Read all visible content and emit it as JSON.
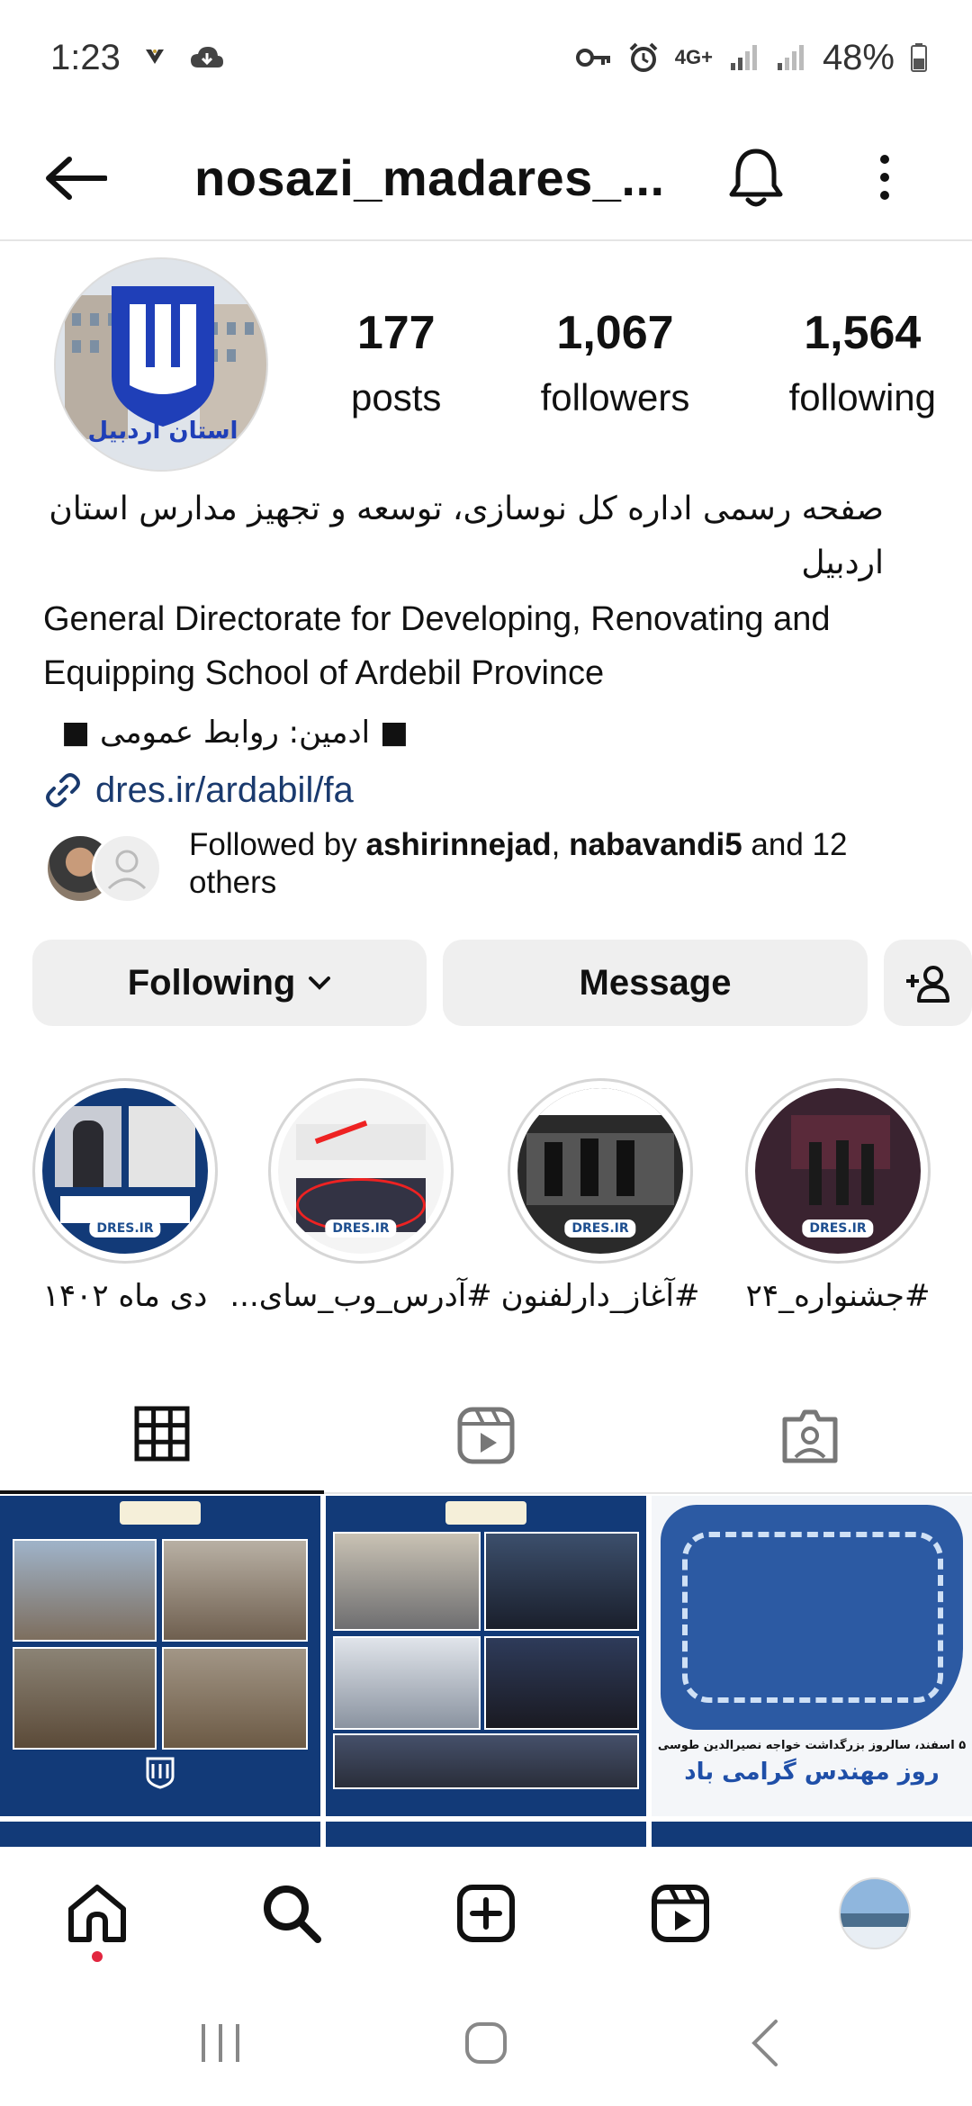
{
  "status_bar": {
    "time": "1:23",
    "network": "4G+",
    "battery": "48%"
  },
  "header": {
    "username": "nosazi_madares_..."
  },
  "profile": {
    "stats": [
      {
        "value": "177",
        "label": "posts"
      },
      {
        "value": "1,067",
        "label": "followers"
      },
      {
        "value": "1,564",
        "label": "following"
      }
    ],
    "bio_fa_line1": "صفحه رسمی اداره کل نوسازی، توسعه و تجهیز مدارس استان",
    "bio_fa_line2": "اردبیل",
    "bio_en_line1": "General Directorate for Developing, Renovating and",
    "bio_en_line2": "Equipping School of Ardebil Province",
    "bio_admin": "■ ادمین: روابط عمومی ■",
    "link": "dres.ir/ardabil/fa",
    "avatar_text": "استان اردبیل"
  },
  "followed_by": {
    "prefix": "Followed by ",
    "user1": "ashirinnejad",
    "sep": ", ",
    "user2": "nabavandi5",
    "suffix_line1": " and 12",
    "suffix_line2": "others"
  },
  "actions": {
    "following_label": "Following",
    "message_label": "Message"
  },
  "highlights": [
    {
      "label": "#جشنواره_۲۴"
    },
    {
      "label": "#آغاز_دارلفنون"
    },
    {
      "label": "#آدرس_وب_سای..."
    },
    {
      "label": "دی ماه ۱۴۰۲"
    }
  ],
  "highlight_badge": "DRES.IR",
  "posts": {
    "post3_line1": "روز مهندس گرامی باد",
    "post3_line2": "۵ اسفند، سالروز بزرگداشت خواجه نصیرالدین طوسی"
  },
  "colors": {
    "accent_navy": "#123a78",
    "link": "#1a3a6e",
    "notification_dot": "#e2263f"
  }
}
